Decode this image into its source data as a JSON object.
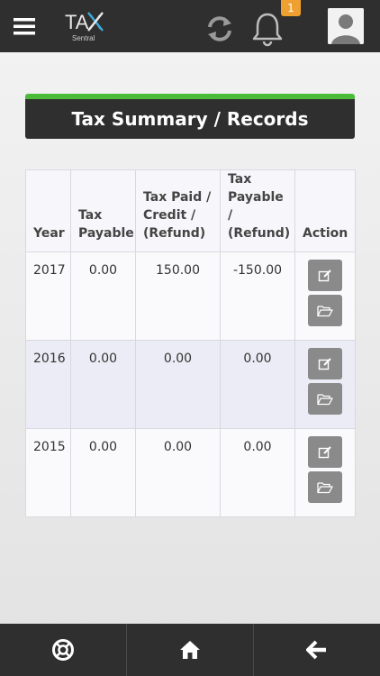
{
  "header": {
    "logo_text": "TAX",
    "logo_sub": "Sentral",
    "notification_count": "1",
    "icons": {
      "menu": "hamburger-icon",
      "sync": "sync-icon",
      "bell": "bell-icon",
      "avatar": "user-avatar"
    }
  },
  "page": {
    "title": "Tax Summary / Records"
  },
  "table": {
    "headers": {
      "year": "Year",
      "tax_payable": "Tax Payable",
      "tax_paid": "Tax Paid / Credit / (Refund)",
      "balance": "Tax Payable / (Refund)",
      "action": "Action"
    },
    "rows": [
      {
        "year": "2017",
        "tax_payable": "0.00",
        "tax_paid": "150.00",
        "balance": "-150.00"
      },
      {
        "year": "2016",
        "tax_payable": "0.00",
        "tax_paid": "0.00",
        "balance": "0.00"
      },
      {
        "year": "2015",
        "tax_payable": "0.00",
        "tax_paid": "0.00",
        "balance": "0.00"
      }
    ]
  },
  "footer": {
    "icons": [
      "lifebuoy-icon",
      "home-icon",
      "back-arrow-icon"
    ]
  },
  "colors": {
    "accent": "#4cbb3a",
    "bar": "#2f2f2f",
    "badge": "#f0a030",
    "action_button": "#8a8a8a"
  }
}
